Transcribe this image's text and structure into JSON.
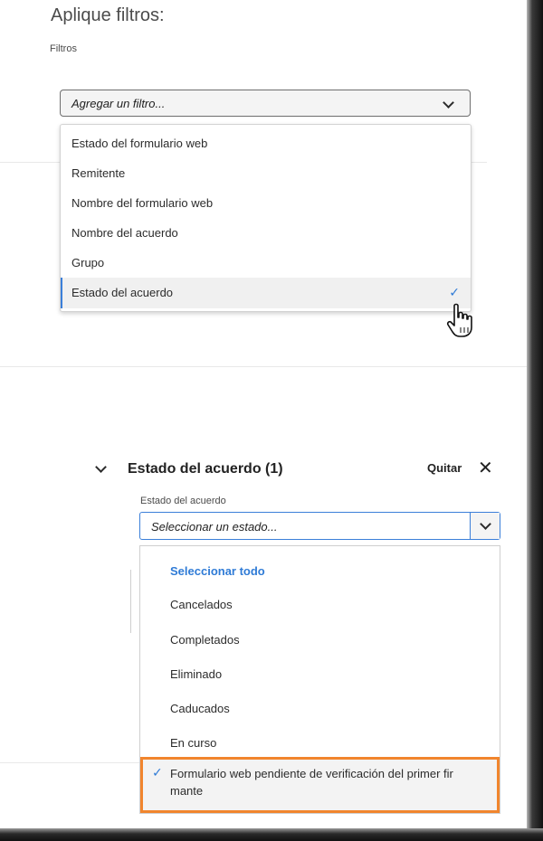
{
  "page": {
    "title": "Aplique filtros:",
    "filters_label": "Filtros"
  },
  "filter_select": {
    "placeholder": "Agregar un filtro..."
  },
  "filter_menu": {
    "items": [
      {
        "label": "Estado del formulario web",
        "selected": false
      },
      {
        "label": "Remitente",
        "selected": false
      },
      {
        "label": "Nombre del formulario web",
        "selected": false
      },
      {
        "label": "Nombre del acuerdo",
        "selected": false
      },
      {
        "label": "Grupo",
        "selected": false
      },
      {
        "label": "Estado del acuerdo",
        "selected": true
      }
    ],
    "check_glyph": "✓"
  },
  "section": {
    "title": "Estado del acuerdo (1)",
    "remove_label": "Quitar",
    "close_glyph": "✕"
  },
  "state_field": {
    "label": "Estado del acuerdo",
    "placeholder": "Seleccionar un estado..."
  },
  "state_menu": {
    "select_all": "Seleccionar todo",
    "items": [
      "Cancelados",
      "Completados",
      "Eliminado",
      "Caducados",
      "En curso"
    ],
    "highlighted_item": "Formulario web pendiente de verificación del primer fir mante",
    "check_glyph": "✓"
  },
  "colors": {
    "accent_blue": "#2f7bd6",
    "highlight_orange": "#f1852d"
  },
  "icons": [
    "chevron-down-icon",
    "checkmark-icon",
    "hand-cursor-icon",
    "close-icon"
  ]
}
